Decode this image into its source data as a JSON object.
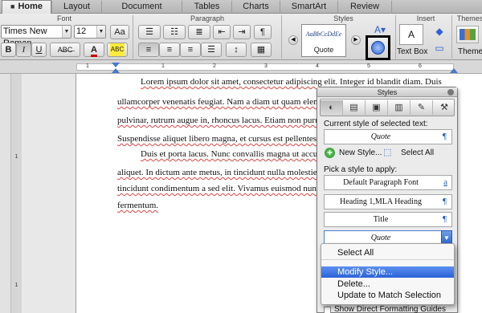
{
  "tabs": [
    {
      "label": "Home",
      "active": true
    },
    {
      "label": "Layout"
    },
    {
      "label": "Document Elements"
    },
    {
      "label": "Tables"
    },
    {
      "label": "Charts"
    },
    {
      "label": "SmartArt"
    },
    {
      "label": "Review"
    }
  ],
  "ribbon": {
    "font_group": "Font",
    "paragraph_group": "Paragraph",
    "styles_group": "Styles",
    "insert_group": "Insert",
    "themes_group": "Themes",
    "font_name": "Times New Roman",
    "font_size": "12",
    "aa_label": "Aa",
    "bold": "B",
    "italic": "I",
    "underline": "U",
    "abc_label": "ABC",
    "style_sample": "AaBbCcDdEe",
    "style_name": "Quote",
    "textbox_label": "Text Box",
    "themes_label": "Themes"
  },
  "ruler": {
    "numbers": [
      "1",
      "1",
      "2",
      "3",
      "4",
      "5",
      "6"
    ],
    "vnumbers": [
      "1",
      "1"
    ]
  },
  "document": {
    "lines": [
      "Lorem ipsum dolor sit amet, consectetur adipiscing elit. Integer id blandit diam. Duis",
      "ullamcorper venenatis feugiat. Nam a diam ut quam elementum co",
      "pulvinar, rutrum augue in, rhoncus lacus. Etiam non purus sed lac",
      "Suspendisse aliquet libero magna, et cursus est pellentesque ut.",
      "Duis et porta lacus. Nunc convallis magna ut accumsan ter",
      "aliquet. In dictum ante metus, in tincidunt nulla molestie nec. Cras",
      "tincidunt condimentum a sed elit. Vivamus euismod nunc sem, at",
      "fermentum."
    ]
  },
  "styles_panel": {
    "title": "Styles",
    "current_label": "Current style of selected text:",
    "current_value": "Quote",
    "new_style": "New Style...",
    "select_all": "Select All",
    "pick_label": "Pick a style to apply:",
    "styles": [
      {
        "name": "Default Paragraph Font",
        "marker": "a"
      },
      {
        "name": "Heading 1,MLA Heading",
        "marker": "¶"
      },
      {
        "name": "Title",
        "marker": "¶"
      },
      {
        "name": "Quote",
        "marker": "▼"
      }
    ],
    "footer_l": "L",
    "footer_checkbox": "Show Direct Formatting Guides"
  },
  "context_menu": {
    "items": [
      {
        "label": "Select All"
      },
      {
        "label": "Modify Style...",
        "highlighted": true
      },
      {
        "label": "Delete..."
      },
      {
        "label": "Update to Match Selection"
      }
    ]
  },
  "colors": {
    "accent": "#2a62d8",
    "spell_underline": "#dd4444",
    "link_blue": "#1f5fbf"
  }
}
